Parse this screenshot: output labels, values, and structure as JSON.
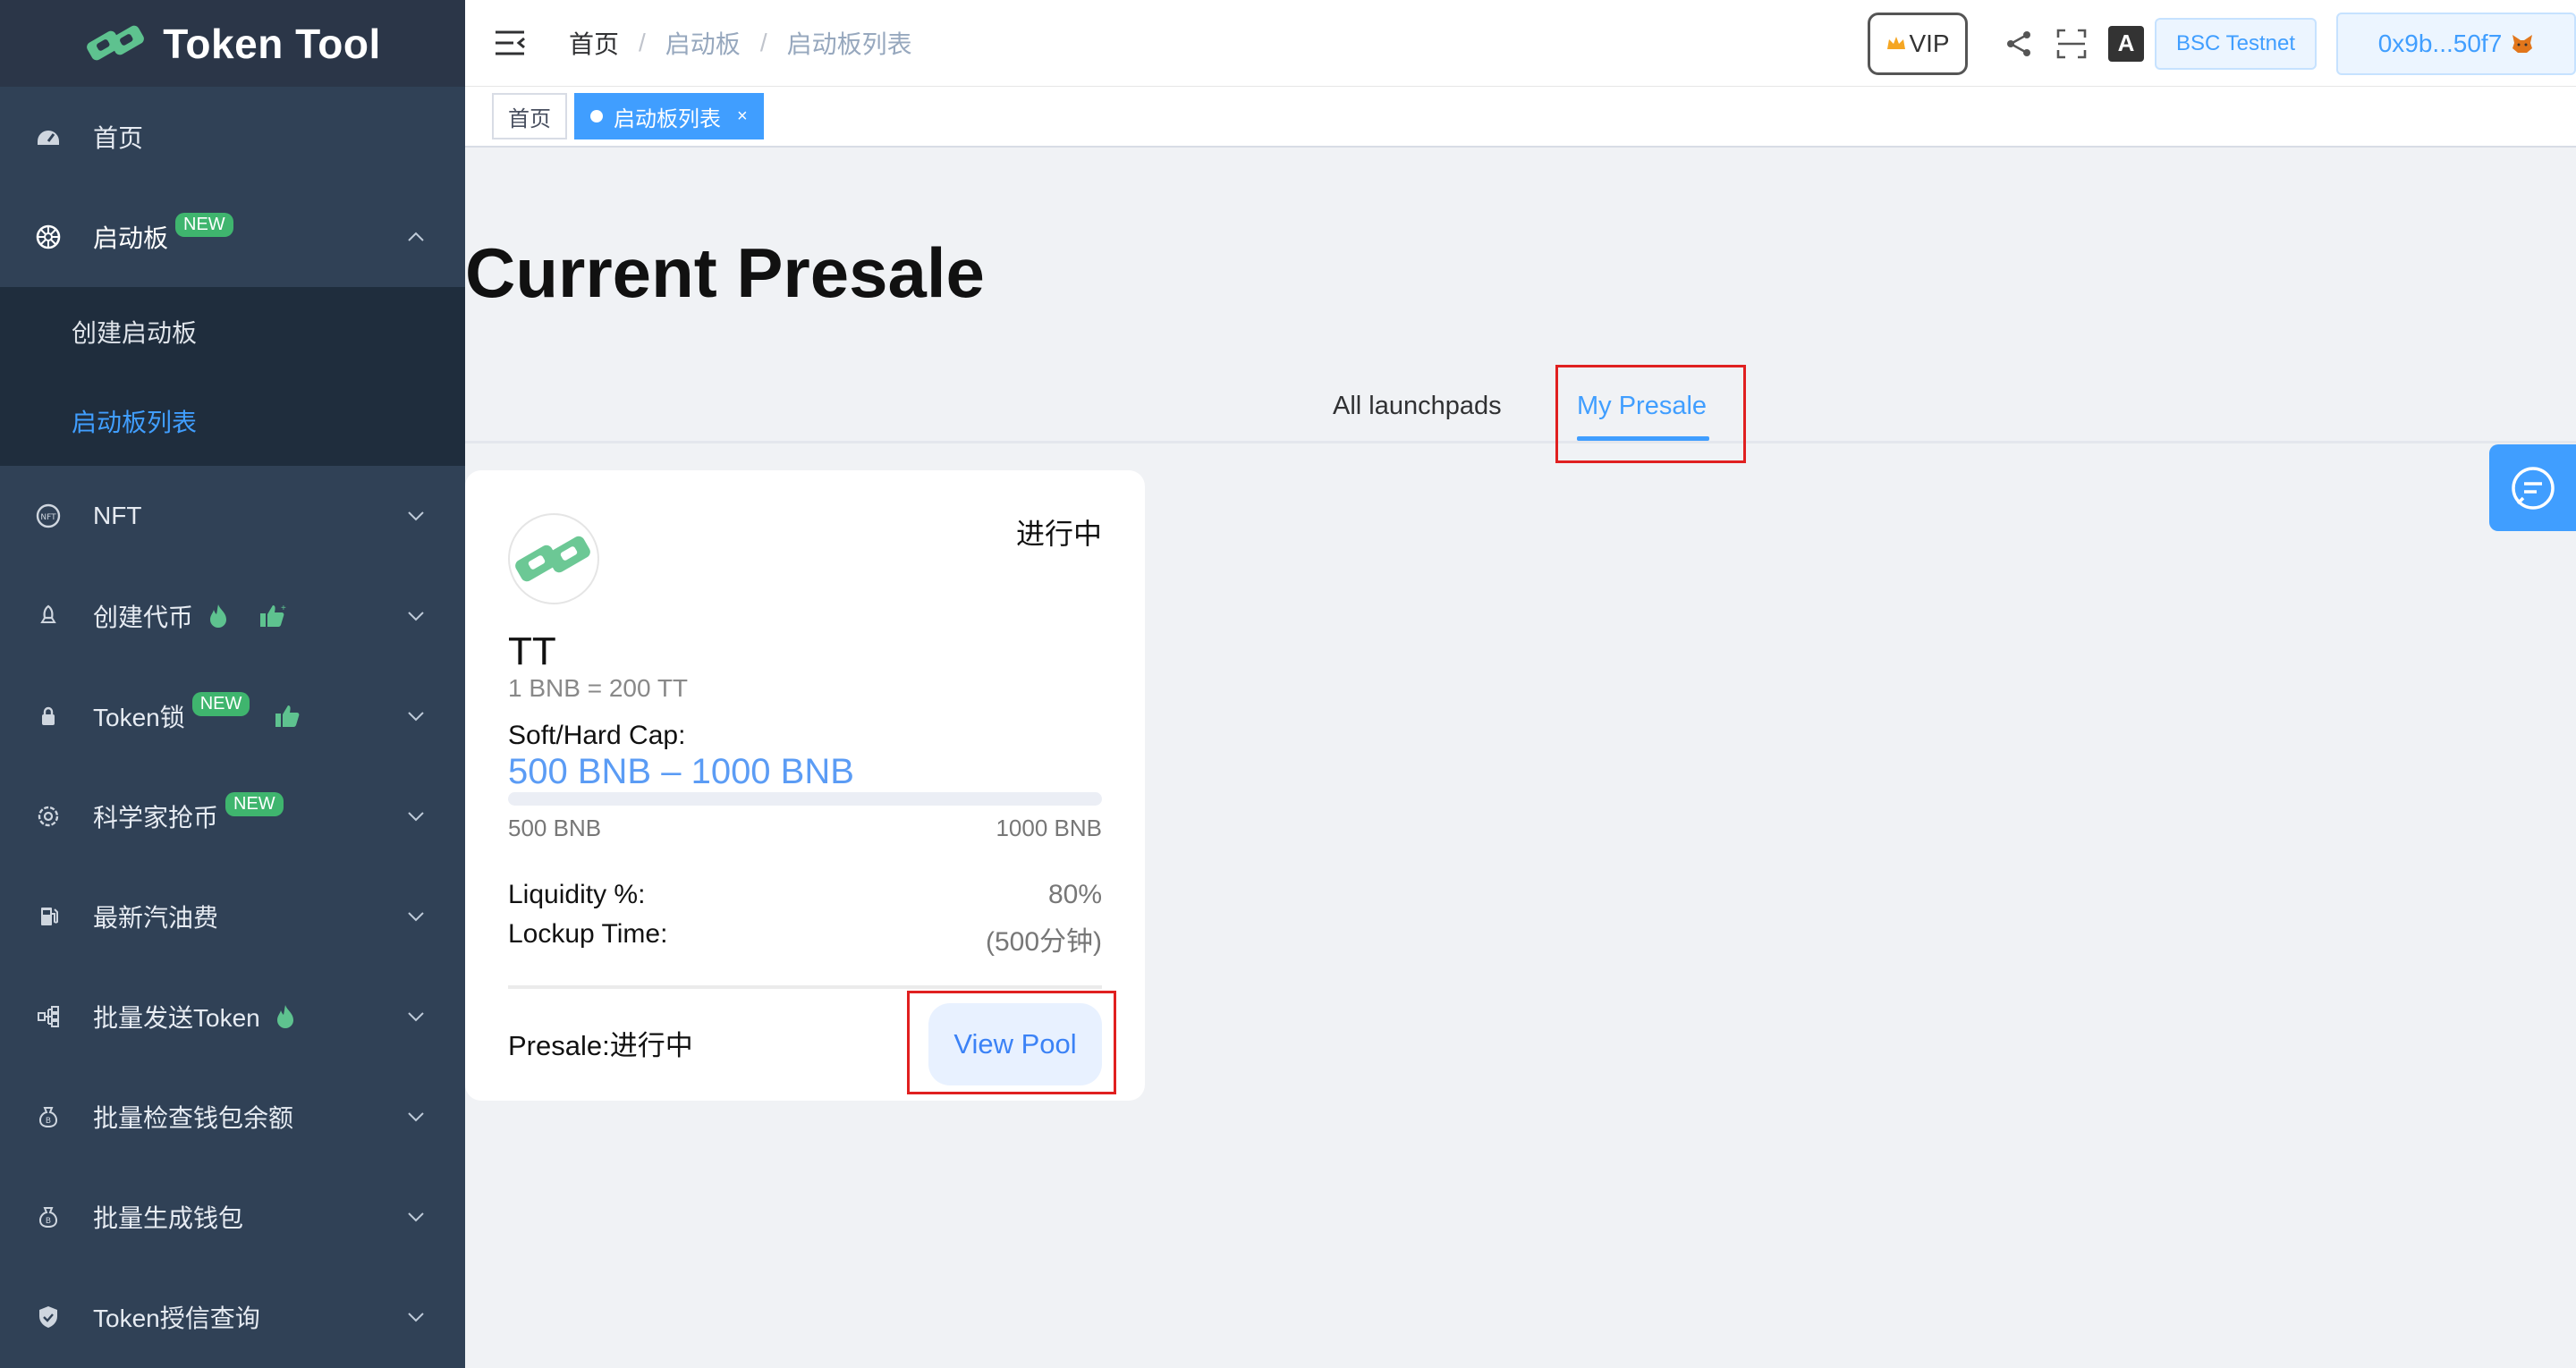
{
  "app": {
    "name": "Token Tool"
  },
  "sidebar": {
    "home": "首页",
    "launchpad": {
      "label": "启动板",
      "badge": "NEW"
    },
    "launchpad_sub": [
      {
        "label": "创建启动板"
      },
      {
        "label": "启动板列表",
        "active": true
      }
    ],
    "items": [
      {
        "label": "NFT",
        "icon": "nft-icon"
      },
      {
        "label": "创建代币",
        "icon": "rocket-icon",
        "extra": [
          "fire-icon",
          "thumbs-up-icon"
        ]
      },
      {
        "label": "Token锁",
        "icon": "lock-icon",
        "badge": "NEW",
        "extra": [
          "thumbs-up-icon"
        ]
      },
      {
        "label": "科学家抢币",
        "icon": "gear-icon",
        "badge": "NEW"
      },
      {
        "label": "最新汽油费",
        "icon": "fuel-icon"
      },
      {
        "label": "批量发送Token",
        "icon": "tree-icon",
        "extra": [
          "fire-icon"
        ]
      },
      {
        "label": "批量检查钱包余额",
        "icon": "money-bag-icon"
      },
      {
        "label": "批量生成钱包",
        "icon": "money-bag-icon"
      },
      {
        "label": "Token授信查询",
        "icon": "shield-icon"
      }
    ]
  },
  "header": {
    "breadcrumb": [
      "首页",
      "启动板",
      "启动板列表"
    ],
    "vip": "VIP",
    "network": "BSC Testnet",
    "address": "0x9b...50f7"
  },
  "tags": {
    "home": "首页",
    "current": "启动板列表",
    "close": "×"
  },
  "main": {
    "title": "Current Presale",
    "tabs": {
      "all": "All launchpads",
      "mine": "My Presale",
      "active": "mine"
    }
  },
  "card": {
    "status": "进行中",
    "symbol": "TT",
    "rate": "1 BNB = 200 TT",
    "cap_label": "Soft/Hard Cap:",
    "cap": "500 BNB – 1000 BNB",
    "progress": 0,
    "min": "500 BNB",
    "max": "1000 BNB",
    "liquidity_label": "Liquidity %:",
    "liquidity": "80%",
    "lockup_label": "Lockup Time:",
    "lockup": "(500分钟)",
    "presale": "Presale:进行中",
    "view_pool": "View Pool"
  },
  "colors": {
    "sidebar": "#304156",
    "accent": "#409eff",
    "brand": "#3fb56e",
    "highlight": "#e02020"
  }
}
